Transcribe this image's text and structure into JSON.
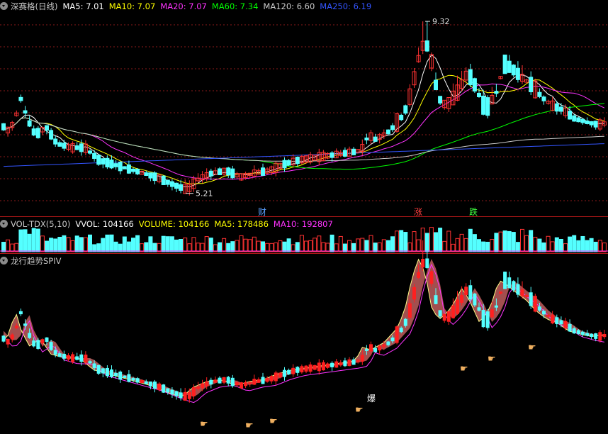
{
  "main_header": {
    "name": "深赛格(日线)",
    "items": [
      {
        "label": "MA5: 7.01",
        "color": "#ffffff"
      },
      {
        "label": "MA10: 7.07",
        "color": "#ffff00"
      },
      {
        "label": "MA20: 7.07",
        "color": "#ff33ff"
      },
      {
        "label": "MA60: 7.34",
        "color": "#00ff00"
      },
      {
        "label": "MA120: 6.60",
        "color": "#cccccc"
      },
      {
        "label": "MA250: 6.19",
        "color": "#3355ff"
      }
    ]
  },
  "vol_header": {
    "name": "VOL-TDX(5,10)",
    "items": [
      {
        "label": "VVOL: 104166",
        "color": "#ffffff"
      },
      {
        "label": "VOLUME: 104166",
        "color": "#ffff00"
      },
      {
        "label": "MA5: 178486",
        "color": "#ffff00"
      },
      {
        "label": "MA10: 192807",
        "color": "#ff33ff"
      }
    ]
  },
  "ind_header": {
    "name": "龙行趋势SPIV"
  },
  "colors": {
    "up": "#ff3232",
    "down": "#54ffff",
    "grid": "#8b1a1a",
    "separator": "#b01818"
  },
  "chart_data": {
    "type": "candlestick",
    "high_label": "9.32",
    "low_label": "5.21",
    "events": [
      {
        "text": "财",
        "color": "#5aa0ff"
      },
      {
        "text": "涨",
        "color": "#ff4040"
      },
      {
        "text": "跌",
        "color": "#40ff40"
      }
    ],
    "indicator_label": "爆"
  }
}
